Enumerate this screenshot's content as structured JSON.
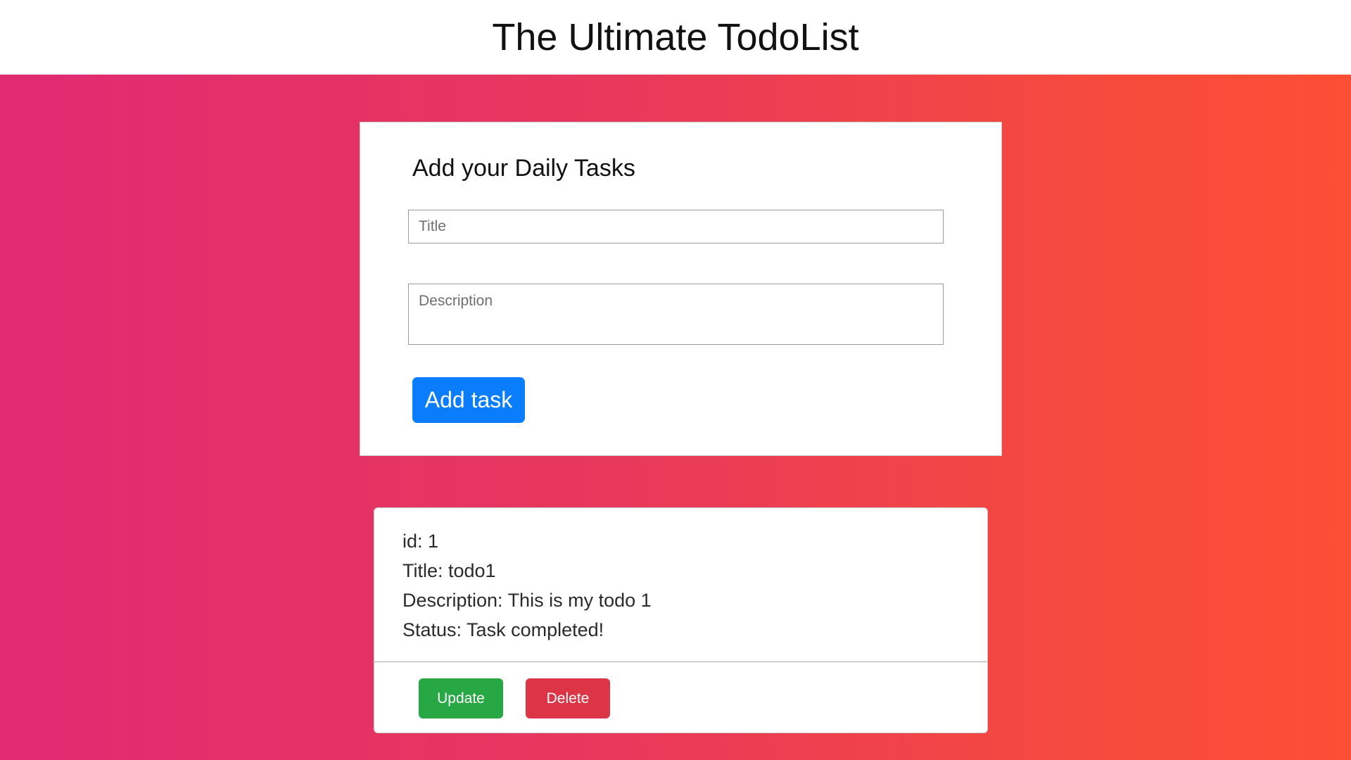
{
  "header": {
    "title": "The Ultimate TodoList"
  },
  "form": {
    "heading": "Add your Daily Tasks",
    "title_placeholder": "Title",
    "description_placeholder": "Description",
    "add_label": "Add task"
  },
  "todos": [
    {
      "id_line": "id: 1",
      "title_line": "Title: todo1",
      "description_line": "Description: This is my todo 1",
      "status_line": "Status: Task completed!",
      "update_label": "Update",
      "delete_label": "Delete"
    }
  ],
  "colors": {
    "gradient_start": "#e02a72",
    "gradient_end": "#fd4f36",
    "primary": "#0a7dfc",
    "success": "#28a745",
    "danger": "#dc3545"
  }
}
